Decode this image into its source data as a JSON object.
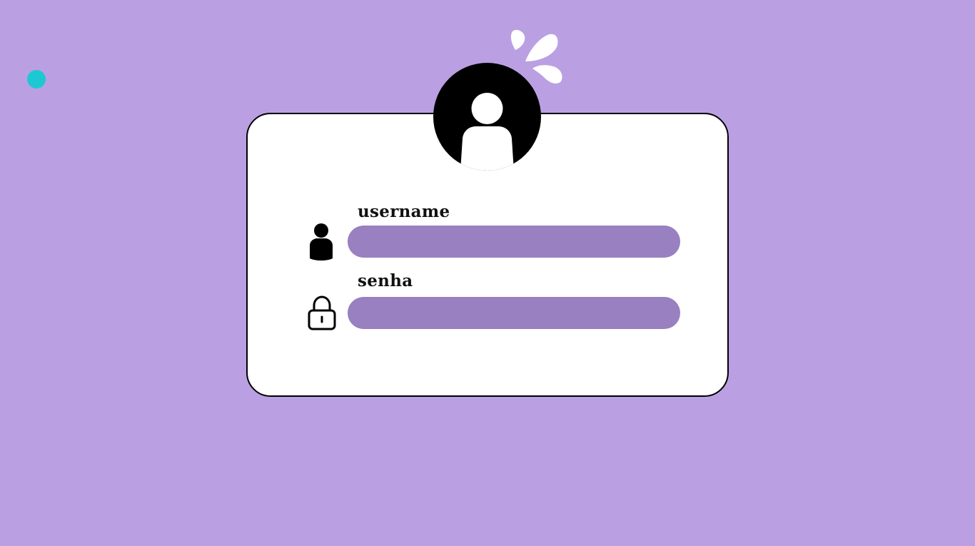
{
  "form": {
    "username": {
      "label": "username",
      "value": "",
      "icon": "user-icon"
    },
    "password": {
      "label": "senha",
      "value": "",
      "icon": "lock-icon"
    }
  },
  "avatar": {
    "icon": "avatar-user-icon"
  },
  "colors": {
    "background": "#baa0e2",
    "card": "#ffffff",
    "input": "#9980c0",
    "accent_dot": "#1ec8d2",
    "avatar": "#000000"
  }
}
